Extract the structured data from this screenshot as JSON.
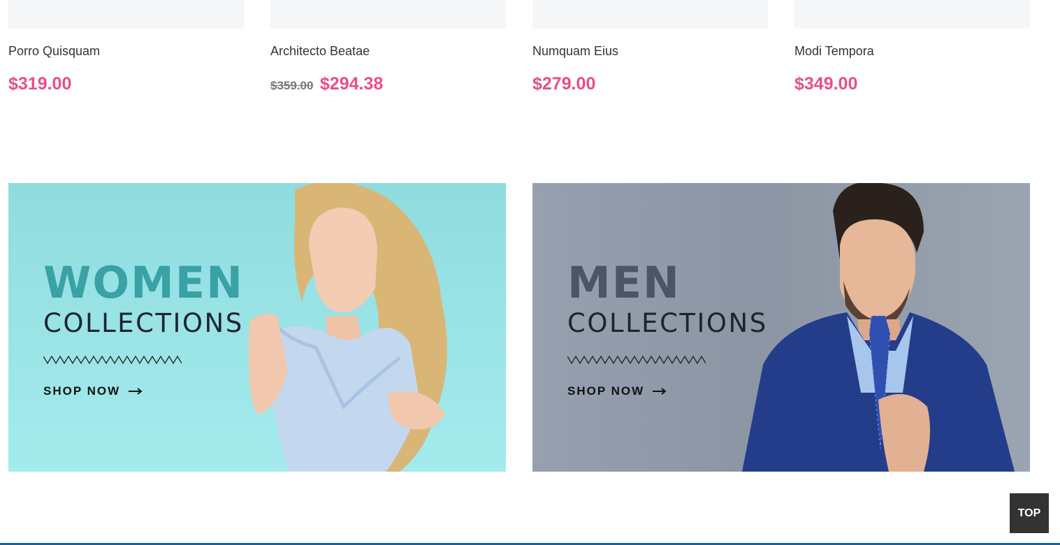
{
  "products": [
    {
      "name": "Porro Quisquam",
      "old_price": "",
      "price": "$319.00"
    },
    {
      "name": "Architecto Beatae",
      "old_price": "$359.00",
      "price": "$294.38"
    },
    {
      "name": "Numquam Eius",
      "old_price": "",
      "price": "$279.00"
    },
    {
      "name": "Modi Tempora",
      "old_price": "",
      "price": "$349.00"
    }
  ],
  "banners": {
    "women": {
      "title": "WOMEN",
      "subtitle": "COLLECTIONS",
      "cta": "SHOP NOW"
    },
    "men": {
      "title": "MEN",
      "subtitle": "COLLECTIONS",
      "cta": "SHOP NOW"
    }
  },
  "back_to_top": "TOP",
  "colors": {
    "price": "#e84e8a",
    "women_bg": "#9ae2e4",
    "women_title": "#3aa1a5",
    "men_bg": "#929cab",
    "men_title": "#4b5563",
    "top_button": "#333333",
    "footer_line": "#1f5f9a"
  },
  "icons": {
    "cta_arrow": "long-arrow-right-icon",
    "divider": "zigzag-icon"
  }
}
